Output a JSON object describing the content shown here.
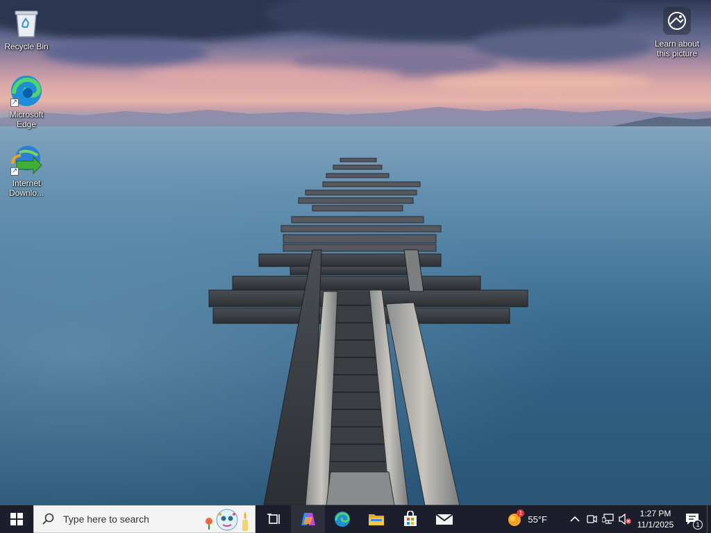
{
  "desktop": {
    "icons": [
      {
        "label": "Recycle Bin"
      },
      {
        "label": "Microsoft\nEdge"
      },
      {
        "label": "Internet\nDownlo..."
      }
    ],
    "learn_about": {
      "label": "Learn about\nthis picture"
    }
  },
  "taskbar": {
    "search_placeholder": "Type here to search",
    "pinned": [
      {
        "name": "task-view",
        "icon": "task-view-icon"
      },
      {
        "name": "copilot",
        "icon": "copilot-icon"
      },
      {
        "name": "microsoft-edge",
        "icon": "edge-icon"
      },
      {
        "name": "file-explorer",
        "icon": "folder-icon"
      },
      {
        "name": "microsoft-store",
        "icon": "store-icon"
      },
      {
        "name": "mail",
        "icon": "mail-icon"
      }
    ],
    "weather": {
      "temperature": "55°F",
      "alert_count": "1"
    },
    "clock": {
      "time": "1:27 PM",
      "date": "11/1/2025"
    },
    "notifications": {
      "count": "1"
    }
  },
  "colors": {
    "taskbar_bg": "#1c1f2b",
    "search_bg": "#f3f3f3",
    "accent_blue": "#0078d4"
  }
}
